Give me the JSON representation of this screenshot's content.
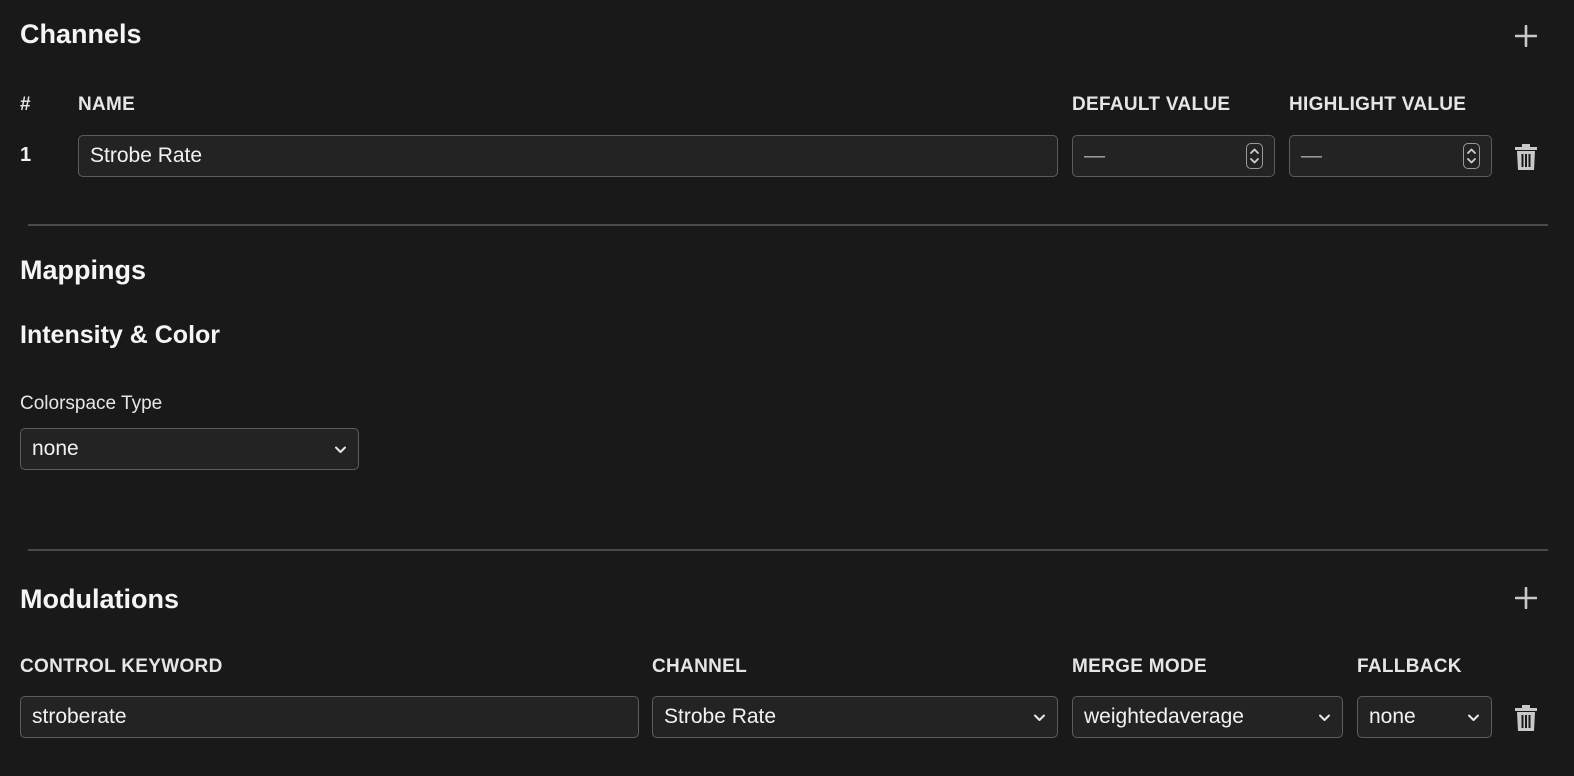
{
  "channels": {
    "title": "Channels",
    "columns": {
      "num": "#",
      "name": "NAME",
      "default_value": "DEFAULT VALUE",
      "highlight_value": "HIGHLIGHT VALUE"
    },
    "rows": [
      {
        "num": "1",
        "name": "Strobe Rate",
        "default_value": "—",
        "highlight_value": "—"
      }
    ]
  },
  "mappings": {
    "title": "Mappings",
    "intensity_color": {
      "title": "Intensity & Color",
      "colorspace_label": "Colorspace Type",
      "colorspace_value": "none"
    }
  },
  "modulations": {
    "title": "Modulations",
    "columns": {
      "control_keyword": "CONTROL KEYWORD",
      "channel": "CHANNEL",
      "merge_mode": "MERGE MODE",
      "fallback": "FALLBACK"
    },
    "rows": [
      {
        "control_keyword": "stroberate",
        "channel": "Strobe Rate",
        "merge_mode": "weightedaverage",
        "fallback": "none"
      }
    ]
  },
  "icons": {
    "add": "plus-icon",
    "delete": "trash-icon",
    "dropdown": "chevron-down-icon",
    "stepper": "spinner-icon"
  }
}
